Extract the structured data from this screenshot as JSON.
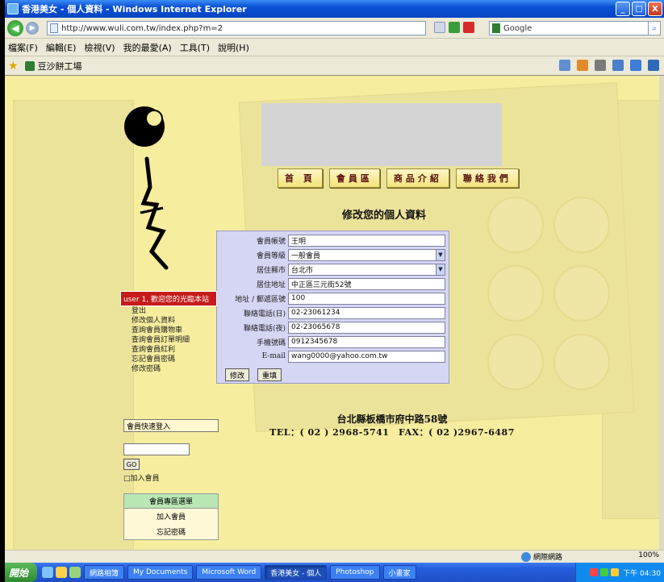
{
  "window": {
    "title": "香港美女 - 個人資料 - Windows Internet Explorer",
    "min_label": "_",
    "max_label": "□",
    "close_label": "X"
  },
  "address": {
    "url": "http://www.wuli.com.tw/index.php?m=2",
    "search_placeholder": "Google"
  },
  "menu": {
    "items": [
      "檔案(F)",
      "編輯(E)",
      "檢視(V)",
      "我的最愛(A)",
      "工具(T)",
      "說明(H)"
    ]
  },
  "favorites": {
    "tab_title": "豆沙餅工場",
    "star": "★"
  },
  "page": {
    "nav": [
      "首 頁",
      "會員區",
      "商品介紹",
      "聯絡我們"
    ],
    "form_title": "修改您的個人資料",
    "form": {
      "rows": [
        {
          "label": "會員帳號",
          "value": "王明"
        },
        {
          "label": "會員等級",
          "value": "一般會員",
          "select": true
        },
        {
          "label": "居住縣市",
          "value": "台北市",
          "select": true
        },
        {
          "label": "居住地址",
          "value": "中正區三元街52號"
        },
        {
          "label": "地址 / 郵遞區號",
          "value": "100"
        },
        {
          "label": "聯絡電話(日)",
          "value": "02-23061234"
        },
        {
          "label": "聯絡電話(夜)",
          "value": "02-23065678"
        },
        {
          "label": "手機號碼",
          "value": "0912345678"
        },
        {
          "label": "E-mail",
          "value": "wang0000@yahoo.com.tw"
        }
      ],
      "submit_label": "修改",
      "reset_label": "重填"
    },
    "sidebar": {
      "head": "user 1, 歡迎您的光臨本站",
      "items": [
        "登出",
        "修改個人資料",
        "查詢會員購物車",
        "查詢會員訂單明細",
        "查詢會員紅利",
        "忘記會員密碼",
        "修改密碼"
      ]
    },
    "login": {
      "head": "會員快速登入",
      "button": "GO",
      "link": "□加入會員"
    },
    "business": {
      "head": "會員專區選單",
      "items": [
        "加入會員",
        "忘記密碼"
      ]
    },
    "footer": {
      "address": "台北縣板橋市府中路58號",
      "tel": "TEL：( 02 ) 2968-5741　FAX：( 02 )2967-6487"
    }
  },
  "status": {
    "zone": "網際網路",
    "zoom": "100%"
  },
  "taskbar": {
    "start": "開始",
    "tasks": [
      "網路相簿",
      "My Documents",
      "Microsoft Word",
      "香港美女 - 個人",
      "Photoshop",
      "小畫家"
    ],
    "clock": "下午 04:30"
  }
}
